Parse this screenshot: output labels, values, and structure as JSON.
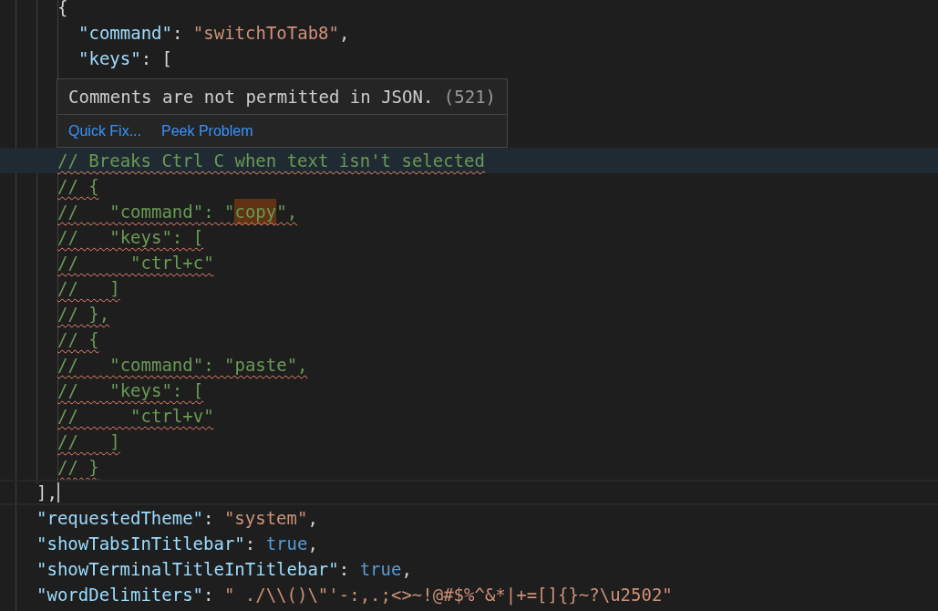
{
  "editor": {
    "lines": [
      {
        "children": [
          {
            "tokens": [
              {
                "kind": "punct",
                "text": "{"
              }
            ]
          },
          {
            "children": [
              {
                "tokens": [
                  {
                    "kind": "key",
                    "text": "\"command\""
                  },
                  {
                    "kind": "punct",
                    "text": ": "
                  },
                  {
                    "kind": "string",
                    "text": "\"switchToTab8\""
                  },
                  {
                    "kind": "punct",
                    "text": ","
                  }
                ]
              },
              {
                "tokens": [
                  {
                    "kind": "key",
                    "text": "\"keys\""
                  },
                  {
                    "kind": "punct",
                    "text": ": ["
                  }
                ]
              },
              {
                "kind": "covered"
              },
              {
                "kind": "covered"
              },
              {
                "kind": "covered"
              }
            ]
          },
          {
            "squiggle": true,
            "highlighted": true,
            "tokens": [
              {
                "kind": "comment",
                "text": "// Breaks Ctrl C when text isn't selected"
              }
            ]
          },
          {
            "squiggle": true,
            "tokens": [
              {
                "kind": "comment",
                "text": "// {"
              }
            ]
          },
          {
            "squiggle": true,
            "tokens": [
              {
                "kind": "comment",
                "text": "//   \"command\": \""
              },
              {
                "kind": "comment",
                "text": "copy",
                "highlighted": true
              },
              {
                "kind": "comment",
                "text": "\","
              }
            ]
          },
          {
            "squiggle": true,
            "tokens": [
              {
                "kind": "comment",
                "text": "//   \"keys\": ["
              }
            ]
          },
          {
            "squiggle": true,
            "tokens": [
              {
                "kind": "comment",
                "text": "//     \"ctrl+c\""
              }
            ]
          },
          {
            "squiggle": true,
            "tokens": [
              {
                "kind": "comment",
                "text": "//   ]"
              }
            ]
          },
          {
            "squiggle": true,
            "tokens": [
              {
                "kind": "comment",
                "text": "// },"
              }
            ]
          },
          {
            "squiggle": true,
            "tokens": [
              {
                "kind": "comment",
                "text": "// {"
              }
            ]
          },
          {
            "squiggle": true,
            "tokens": [
              {
                "kind": "comment",
                "text": "//   \"command\": \"paste\","
              }
            ]
          },
          {
            "squiggle": true,
            "tokens": [
              {
                "kind": "comment",
                "text": "//   \"keys\": ["
              }
            ]
          },
          {
            "squiggle": true,
            "tokens": [
              {
                "kind": "comment",
                "text": "//     \"ctrl+v\""
              }
            ]
          },
          {
            "squiggle": true,
            "tokens": [
              {
                "kind": "comment",
                "text": "//   ]"
              }
            ]
          },
          {
            "squiggle": true,
            "tokens": [
              {
                "kind": "comment",
                "text": "// }"
              }
            ]
          }
        ]
      },
      {
        "current": true,
        "tokens": [
          {
            "kind": "punct",
            "text": "],"
          }
        ]
      },
      {
        "tokens": [
          {
            "kind": "key",
            "text": "\"requestedTheme\""
          },
          {
            "kind": "punct",
            "text": ": "
          },
          {
            "kind": "string",
            "text": "\"system\""
          },
          {
            "kind": "punct",
            "text": ","
          }
        ]
      },
      {
        "tokens": [
          {
            "kind": "key",
            "text": "\"showTabsInTitlebar\""
          },
          {
            "kind": "punct",
            "text": ": "
          },
          {
            "kind": "bool",
            "text": "true"
          },
          {
            "kind": "punct",
            "text": ","
          }
        ]
      },
      {
        "tokens": [
          {
            "kind": "key",
            "text": "\"showTerminalTitleInTitlebar\""
          },
          {
            "kind": "punct",
            "text": ": "
          },
          {
            "kind": "bool",
            "text": "true"
          },
          {
            "kind": "punct",
            "text": ","
          }
        ]
      },
      {
        "tokens": [
          {
            "kind": "key",
            "text": "\"wordDelimiters\""
          },
          {
            "kind": "punct",
            "text": ": "
          },
          {
            "kind": "string",
            "text": "\" ./\\\\()\\\"'-:,.;<>~!@#$%^&*|+=[]{}~?\\u2502\""
          }
        ]
      }
    ]
  },
  "hover": {
    "message": "Comments are not permitted in JSON.",
    "code": "(521)",
    "actions": [
      "Quick Fix...",
      "Peek Problem"
    ]
  }
}
